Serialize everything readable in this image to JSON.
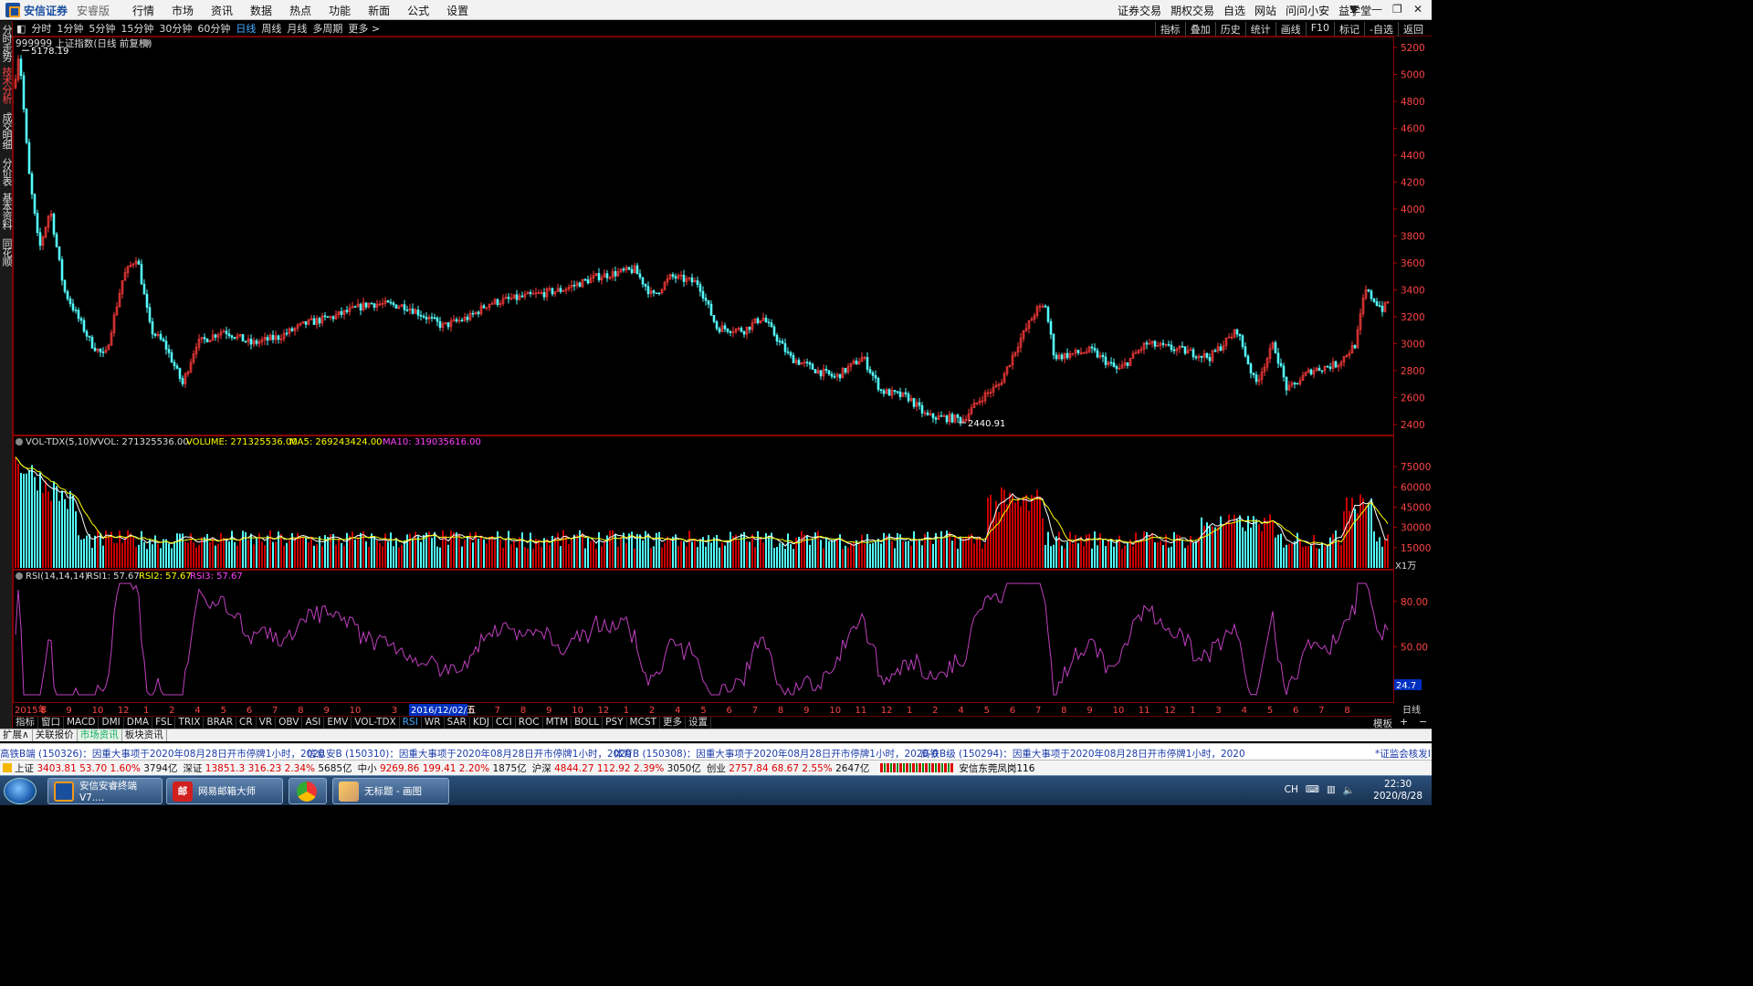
{
  "app": {
    "brand": "安信证券",
    "edition": "安睿版"
  },
  "menu": [
    "行情",
    "市场",
    "资讯",
    "数据",
    "热点",
    "功能",
    "新面",
    "公式",
    "设置"
  ],
  "right_menu": [
    "证券交易",
    "期权交易",
    "自选",
    "网站",
    "问问小安",
    "益学堂"
  ],
  "periods": [
    "分时",
    "1分钟",
    "5分钟",
    "15分钟",
    "30分钟",
    "60分钟",
    "日线",
    "周线",
    "月线",
    "多周期",
    "更多 >"
  ],
  "active_period": "日线",
  "tools": [
    "指标",
    "叠加",
    "历史",
    "统计",
    "画线",
    "F10",
    "标记",
    "-自选",
    "返回"
  ],
  "left_tabs": [
    "分时走势",
    "技术分析",
    "成交明细",
    "分价表",
    "基本资料",
    "同花顺"
  ],
  "main_title": "999999 上证指数(日线 前复权)",
  "price_high_label": "5178.19",
  "price_low_label": "2440.91",
  "price_axis": [
    "5200",
    "5000",
    "4800",
    "4600",
    "4400",
    "4200",
    "4000",
    "3800",
    "3600",
    "3400",
    "3200",
    "3000",
    "2800",
    "2600",
    "2400"
  ],
  "vol_info": {
    "name": "VOL-TDX(5,10)",
    "vvol": "VVOL: 271325536.00",
    "volume": "VOLUME: 271325536.00",
    "ma5": "MA5: 269243424.00",
    "ma10": "MA10: 319035616.00"
  },
  "vol_axis": [
    "75000",
    "60000",
    "45000",
    "30000",
    "15000"
  ],
  "vol_unit": "X1万",
  "rsi_info": {
    "name": "RSI(14,14,14)",
    "rsi1": "RSI1: 57.67",
    "rsi2": "RSI2: 57.67",
    "rsi3": "RSI3: 57.67"
  },
  "rsi_axis": [
    "80.00",
    "50.00"
  ],
  "rsi_current": "24.7",
  "x_labels": [
    "2015年",
    "8",
    "9",
    "10",
    "12",
    "1",
    "2",
    "4",
    "5",
    "6",
    "7",
    "8",
    "9",
    "10",
    "3",
    "4",
    "5",
    "6",
    "7",
    "8",
    "9",
    "10",
    "12",
    "1",
    "2",
    "4",
    "5",
    "6",
    "7",
    "8",
    "9",
    "10",
    "11",
    "12",
    "1",
    "2",
    "4",
    "5",
    "6",
    "7",
    "8",
    "9",
    "10",
    "11",
    "12",
    "1",
    "3",
    "4",
    "5",
    "6",
    "7",
    "8"
  ],
  "x_cursor": "2016/12/02/五",
  "x_period_label": "日线",
  "indicator_tabs": [
    "指标",
    "窗口",
    "MACD",
    "DMI",
    "DMA",
    "FSL",
    "TRIX",
    "BRAR",
    "CR",
    "VR",
    "OBV",
    "ASI",
    "EMV",
    "VOL-TDX",
    "RSI",
    "WR",
    "SAR",
    "KDJ",
    "CCI",
    "ROC",
    "MTM",
    "BOLL",
    "PSY",
    "MCST",
    "更多",
    "设置"
  ],
  "active_indicator": "RSI",
  "template_label": "模板",
  "expand_tabs": [
    "扩展∧",
    "关联报价",
    "市场资讯",
    "板块资讯"
  ],
  "news": [
    "高铁B端 (150326)：因重大事项于2020年08月28日开市停牌1小时，2020",
    "信息安B (150310)：因重大事项于2020年08月28日开市停牌1小时，2020",
    "体育B (150308)：因重大事项于2020年08月28日开市停牌1小时，2020-0",
    "高铁B级 (150294)：因重大事项于2020年08月28日开市停牌1小时，2020",
    "*证监会核发I"
  ],
  "quotes": [
    {
      "name": "上证",
      "price": "3403.81",
      "chg": "53.70",
      "pct": "1.60%",
      "amt": "3794亿"
    },
    {
      "name": "深证",
      "price": "13851.3",
      "chg": "316.23",
      "pct": "2.34%",
      "amt": "5685亿"
    },
    {
      "name": "中小",
      "price": "9269.86",
      "chg": "199.41",
      "pct": "2.20%",
      "amt": "1875亿"
    },
    {
      "name": "沪深",
      "price": "4844.27",
      "chg": "112.92",
      "pct": "2.39%",
      "amt": "3050亿"
    },
    {
      "name": "创业",
      "price": "2757.84",
      "chg": "68.67",
      "pct": "2.55%",
      "amt": "2647亿"
    }
  ],
  "branch": "安信东莞凤岗116",
  "taskbar": [
    "安信安睿终端V7....",
    "网易邮箱大师",
    "无标题 - 画图"
  ],
  "tray": {
    "lang": "CH",
    "time": "22:30",
    "date": "2020/8/28"
  },
  "colors": {
    "up": "#ff3b3b",
    "down": "#54ffff",
    "ma5": "#ffffff",
    "ma10": "#ffff00",
    "rsi": "#c040c0",
    "grid": "#6b0000"
  }
}
